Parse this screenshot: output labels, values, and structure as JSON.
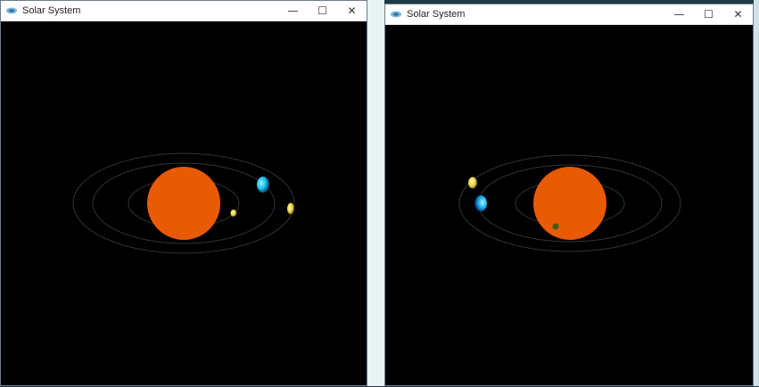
{
  "windows": [
    {
      "title": "Solar System",
      "controls": {
        "minimize": "—",
        "maximize": "☐",
        "close": "✕"
      }
    },
    {
      "title": "Solar System",
      "controls": {
        "minimize": "—",
        "maximize": "☐",
        "close": "✕"
      }
    }
  ],
  "colors": {
    "sun": "#e85a04",
    "orbit": "#3a3a3a",
    "planet_yellow": "#e8d33a",
    "planet_cyan": "#16c2f3",
    "planet_dark": "#3d5c1a"
  }
}
